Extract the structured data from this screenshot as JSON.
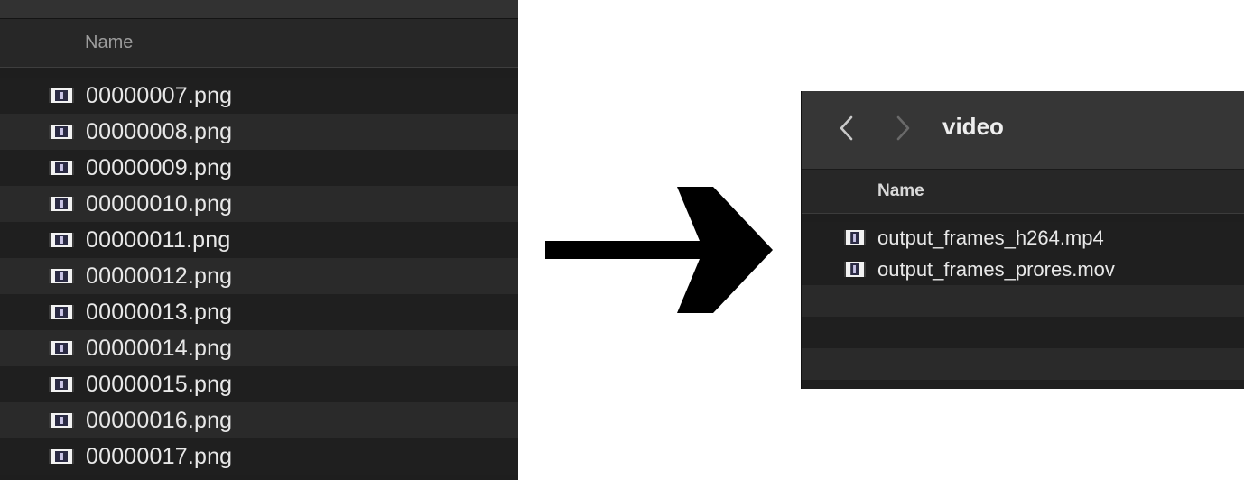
{
  "left_window": {
    "column_header": "Name",
    "files": [
      {
        "name": "00000007.png",
        "icon": "image-file-icon"
      },
      {
        "name": "00000008.png",
        "icon": "image-file-icon"
      },
      {
        "name": "00000009.png",
        "icon": "image-file-icon"
      },
      {
        "name": "00000010.png",
        "icon": "image-file-icon"
      },
      {
        "name": "00000011.png",
        "icon": "image-file-icon"
      },
      {
        "name": "00000012.png",
        "icon": "image-file-icon"
      },
      {
        "name": "00000013.png",
        "icon": "image-file-icon"
      },
      {
        "name": "00000014.png",
        "icon": "image-file-icon"
      },
      {
        "name": "00000015.png",
        "icon": "image-file-icon"
      },
      {
        "name": "00000016.png",
        "icon": "image-file-icon"
      },
      {
        "name": "00000017.png",
        "icon": "image-file-icon"
      }
    ]
  },
  "arrow": {
    "icon": "right-arrow-icon",
    "color": "#000000"
  },
  "right_window": {
    "folder_title": "video",
    "back_icon": "chevron-left-icon",
    "forward_icon": "chevron-right-icon",
    "column_header": "Name",
    "files": [
      {
        "name": "output_frames_h264.mp4",
        "icon": "video-file-icon"
      },
      {
        "name": "output_frames_prores.mov",
        "icon": "video-file-icon"
      }
    ]
  },
  "colors": {
    "window_bg": "#1e1e1e",
    "row_alt": "#2a2a2a",
    "text": "#e8e8e8",
    "header_text": "#9d9d9d"
  }
}
